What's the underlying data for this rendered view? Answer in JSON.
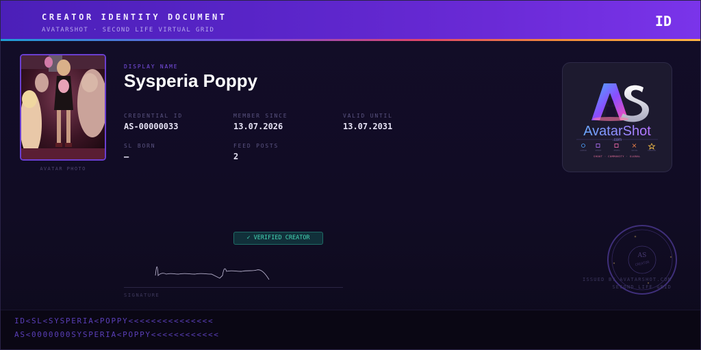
{
  "header": {
    "title": "CREATOR IDENTITY DOCUMENT",
    "subtitle": "AVATARSHOT · SECOND LIFE VIRTUAL GRID",
    "badge": "ID"
  },
  "photo": {
    "label": "AVATAR PHOTO"
  },
  "identity": {
    "display_name_label": "DISPLAY NAME",
    "display_name": "Sysperia Poppy",
    "credential_id_label": "CREDENTIAL ID",
    "credential_id": "AS-00000033",
    "member_since_label": "MEMBER SINCE",
    "member_since": "13.07.2026",
    "valid_until_label": "VALID UNTIL",
    "valid_until": "13.07.2031",
    "sl_born_label": "SL BORN",
    "sl_born": "—",
    "feed_posts_label": "FEED POSTS",
    "feed_posts": "2"
  },
  "logo": {
    "monogram": "AS",
    "wordmark": "AvatarShot",
    "domain": ".com",
    "tagline": "SHOOT · COMMUNITY · GLOBAL"
  },
  "verified_badge": "✓ VERIFIED CREATOR",
  "signature": {
    "label": "SIGNATURE"
  },
  "seal": {
    "monogram": "AS",
    "text": "CREATOR"
  },
  "issued": {
    "line1": "ISSUED BY AVATARSHOT.COM",
    "line2": "SECOND LIFE GRID"
  },
  "mrz": {
    "line1": "ID<SL<SYSPERIA<POPPY<<<<<<<<<<<<<<<",
    "line2": "AS<0000000SYSPERIA<POPPY<<<<<<<<<<<<"
  },
  "colors": {
    "header_start": "#4b1fb8",
    "header_end": "#7a34ea",
    "accent": "#7a4fe6",
    "verified": "#45d6b5",
    "background": "#120d28"
  }
}
